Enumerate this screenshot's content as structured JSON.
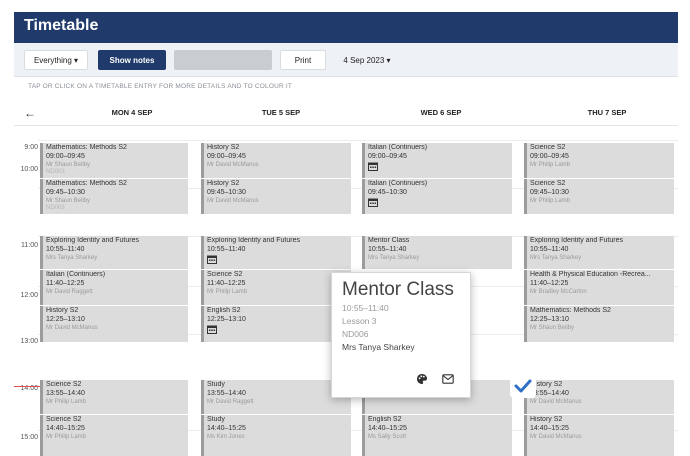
{
  "app": {
    "title": "Timetable"
  },
  "toolbar": {
    "filter": "Everything ▾",
    "notes": "Show notes",
    "print": "Print",
    "date": "4 Sep 2023 ▾"
  },
  "hint": "TAP OR CLICK ON A TIMETABLE ENTRY FOR MORE DETAILS AND TO COLOUR IT",
  "days": [
    "MON 4 SEP",
    "TUE 5 SEP",
    "WED 6 SEP",
    "THU 7 SEP"
  ],
  "hours": [
    "9:00",
    "10:00",
    "11:00",
    "12:00",
    "13:00",
    "14:00",
    "15:00"
  ],
  "entries": {
    "mon": [
      {
        "name": "Mathematics: Methods S2",
        "time": "09:00–09:45",
        "teacher": "Mr Shaun Beilby",
        "room": "ND003"
      },
      {
        "name": "Mathematics: Methods S2",
        "time": "09:45–10:30",
        "teacher": "Mr Shaun Beilby",
        "room": "ND003"
      },
      {
        "name": "Exploring Identity and Futures",
        "time": "10:55–11:40",
        "teacher": "Mrs Tanya Sharkey",
        "room": ""
      },
      {
        "name": "Italian (Continuers)",
        "time": "11:40–12:25",
        "teacher": "Mr David Raggett",
        "room": ""
      },
      {
        "name": "History S2",
        "time": "12:25–13:10",
        "teacher": "Mr David McManus",
        "room": ""
      },
      {
        "name": "Science S2",
        "time": "13:55–14:40",
        "teacher": "Mr Philip Lamb",
        "room": ""
      },
      {
        "name": "Science S2",
        "time": "14:40–15:25",
        "teacher": "Mr Philip Lamb",
        "room": ""
      }
    ],
    "tue": [
      {
        "name": "History S2",
        "time": "09:00–09:45",
        "teacher": "Mr David McManus",
        "room": ""
      },
      {
        "name": "History S2",
        "time": "09:45–10:30",
        "teacher": "Mr David McManus",
        "room": ""
      },
      {
        "name": "Exploring Identity and Futures",
        "time": "10:55–11:40",
        "teacher": "",
        "room": ""
      },
      {
        "name": "Science S2",
        "time": "11:40–12:25",
        "teacher": "Mr Philip Lamb",
        "room": ""
      },
      {
        "name": "English S2",
        "time": "12:25–13:10",
        "teacher": "",
        "room": ""
      },
      {
        "name": "Study",
        "time": "13:55–14:40",
        "teacher": "Mr David Raggett",
        "room": ""
      },
      {
        "name": "Study",
        "time": "14:40–15:25",
        "teacher": "Ms Kim Jones",
        "room": ""
      }
    ],
    "wed": [
      {
        "name": "Italian (Continuers)",
        "time": "09:00–09:45",
        "teacher": "",
        "room": ""
      },
      {
        "name": "Italian (Continuers)",
        "time": "09:45–10:30",
        "teacher": "",
        "room": ""
      },
      {
        "name": "Mentor Class",
        "time": "10:55–11:40",
        "teacher": "Mrs Tanya Sharkey",
        "room": ""
      },
      {
        "name": "",
        "time": "",
        "teacher": "Ms Sally Scott",
        "room": ""
      },
      {
        "name": "English S2",
        "time": "14:40–15:25",
        "teacher": "Ms Sally Scott",
        "room": ""
      }
    ],
    "thu": [
      {
        "name": "Science S2",
        "time": "09:00–09:45",
        "teacher": "Mr Philip Lamb",
        "room": ""
      },
      {
        "name": "Science S2",
        "time": "09:45–10:30",
        "teacher": "Mr Philip Lamb",
        "room": ""
      },
      {
        "name": "Exploring Identity and Futures",
        "time": "10:55–11:40",
        "teacher": "Mrs Tanya Sharkey",
        "room": ""
      },
      {
        "name": "Health & Physical Education -Recrea...",
        "time": "11:40–12:25",
        "teacher": "Mr Bradley McCarton",
        "room": ""
      },
      {
        "name": "Mathematics: Methods S2",
        "time": "12:25–13:10",
        "teacher": "Mr Shaun Beilby",
        "room": ""
      },
      {
        "name": "History S2",
        "time": "13:55–14:40",
        "teacher": "Mr David McManus",
        "room": ""
      },
      {
        "name": "History S2",
        "time": "14:40–15:25",
        "teacher": "Mr David McManus",
        "room": ""
      }
    ]
  },
  "popup": {
    "title": "Mentor Class",
    "time": "10:55–11:40",
    "lesson": "Lesson 3",
    "room": "ND006",
    "teacher": "Mrs Tanya Sharkey"
  },
  "icons": {
    "back": "arrow-left-icon",
    "palette": "palette-icon",
    "mail": "mail-icon",
    "confirm": "checkmark-icon",
    "calendar": "calendar-icon"
  },
  "colors": {
    "header": "#1f3a6b",
    "entry": "#dcdcdc",
    "tick": "#2f6fc6",
    "now_line": "#e05050"
  }
}
